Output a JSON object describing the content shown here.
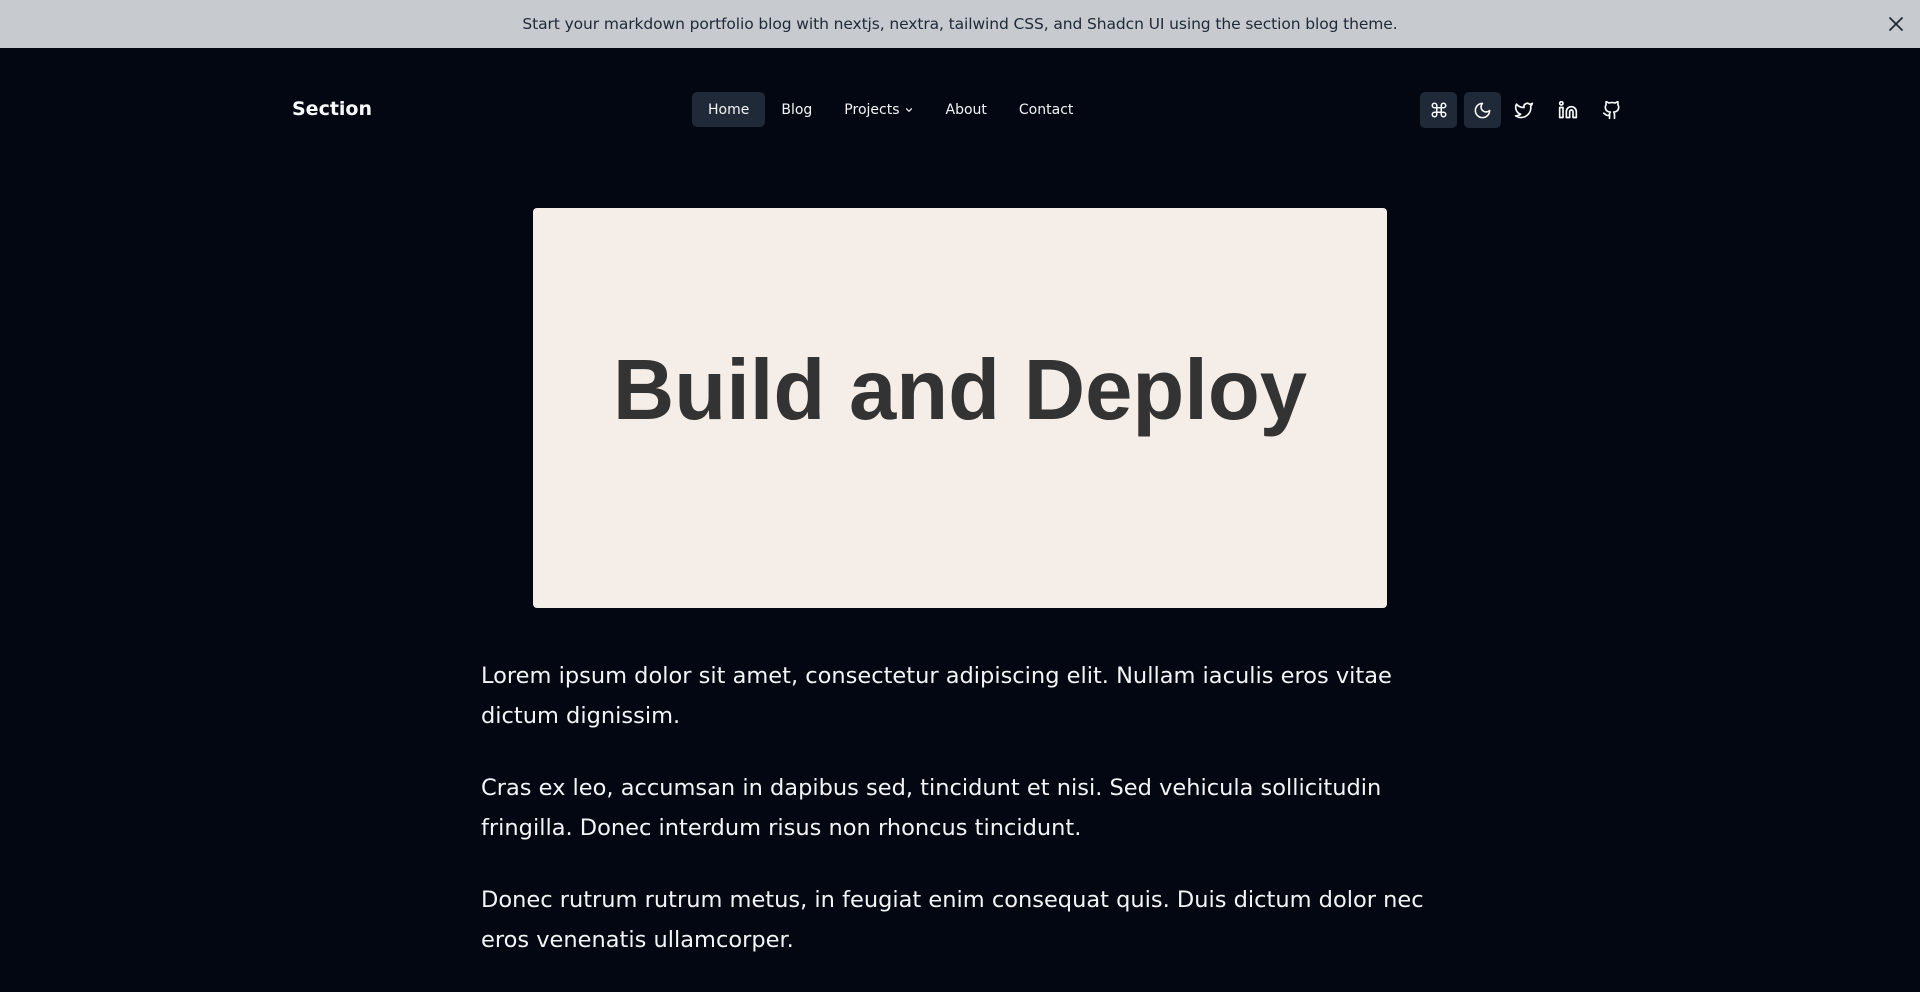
{
  "banner": {
    "text": "Start your markdown portfolio blog with nextjs, nextra, tailwind CSS, and Shadcn UI using  the section blog theme.",
    "close_icon": "close-icon"
  },
  "header": {
    "logo": "Section",
    "nav": [
      {
        "label": "Home",
        "active": true
      },
      {
        "label": "Blog"
      },
      {
        "label": "Projects",
        "has_dropdown": true
      },
      {
        "label": "About"
      },
      {
        "label": "Contact"
      }
    ],
    "icons": [
      "command-icon",
      "moon-icon",
      "twitter-icon",
      "linkedin-icon",
      "github-icon"
    ]
  },
  "hero": {
    "title": "Build and Deploy"
  },
  "content": {
    "paragraphs": [
      "Lorem ipsum dolor sit amet, consectetur adipiscing elit. Nullam iaculis eros vitae dictum dignissim.",
      "Cras ex leo, accumsan in dapibus sed, tincidunt et nisi. Sed vehicula sollicitudin fringilla. Donec interdum risus non rhoncus tincidunt.",
      "Donec rutrum rutrum metus, in feugiat enim consequat quis. Duis dictum dolor nec eros venenatis ullamcorper."
    ]
  },
  "colors": {
    "background": "#030712",
    "banner": "#c7cacf",
    "nav_active": "#1f2937",
    "hero_bg": "#f5eee8",
    "hero_text": "#333333"
  }
}
